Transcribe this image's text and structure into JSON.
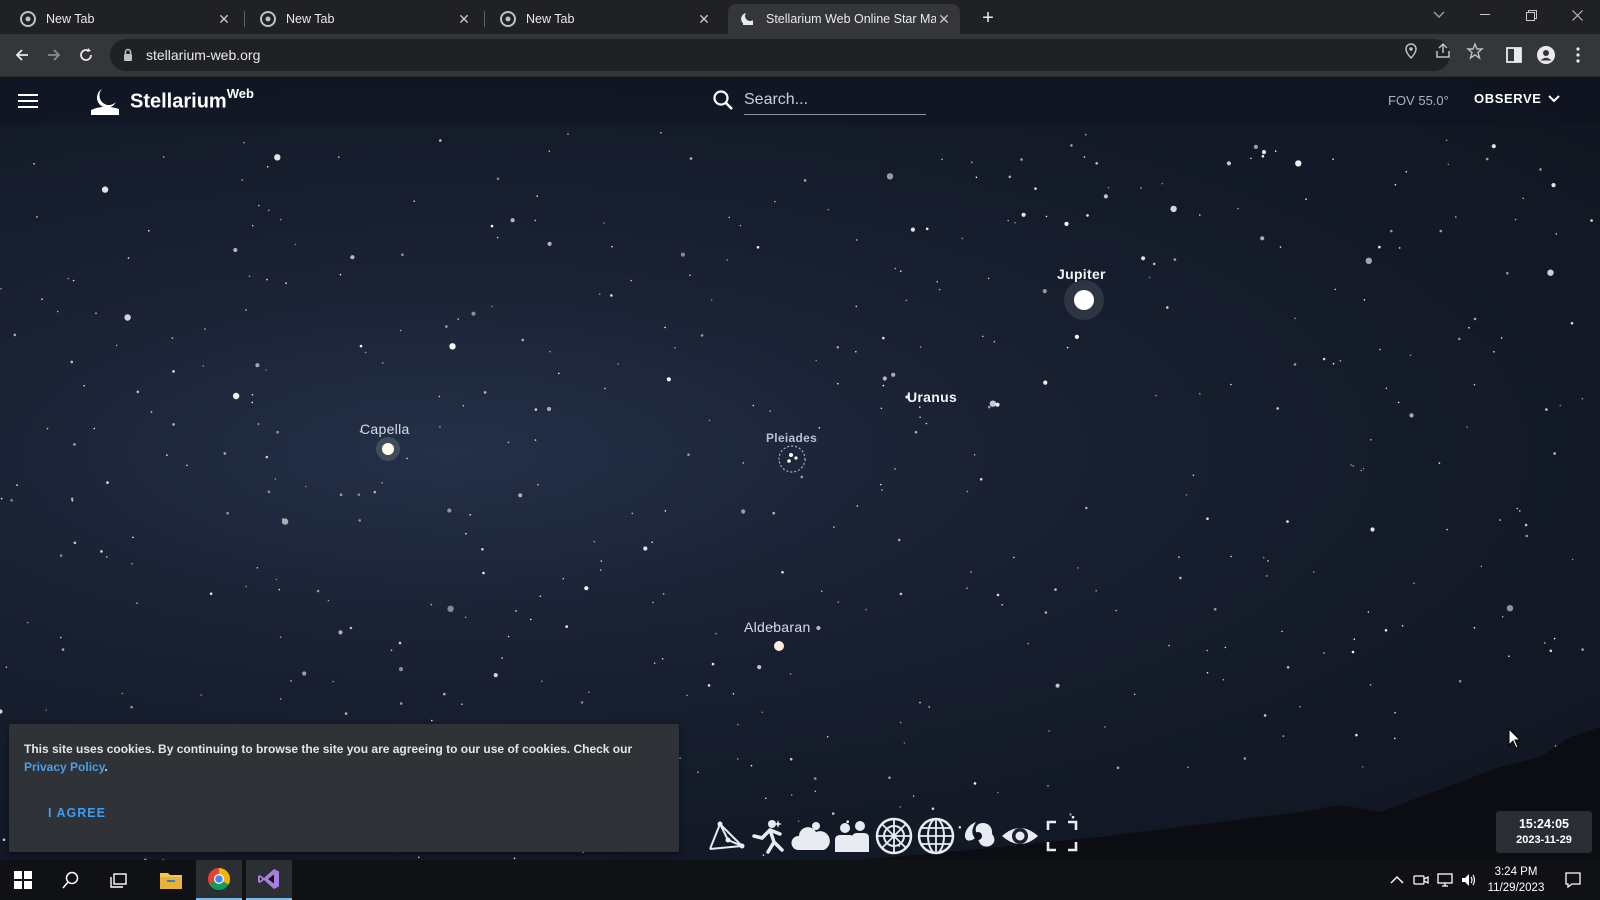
{
  "browser": {
    "tabs": [
      {
        "title": "New Tab",
        "active": false
      },
      {
        "title": "New Tab",
        "active": false
      },
      {
        "title": "New Tab",
        "active": false
      },
      {
        "title": "Stellarium Web Online Star Map",
        "active": true
      }
    ],
    "url": "stellarium-web.org"
  },
  "app": {
    "name": "Stellarium",
    "name_sup": "Web",
    "search_placeholder": "Search...",
    "fov": "FOV 55.0°",
    "observe_label": "OBSERVE"
  },
  "sky_labels": {
    "jupiter": "Jupiter",
    "uranus": "Uranus",
    "capella": "Capella",
    "pleiades": "Pleiades",
    "aldebaran": "Aldebaran"
  },
  "cookie": {
    "text": "This site uses cookies. By continuing to browse the site you are agreeing to our use of cookies. Check our",
    "link": "Privacy Policy",
    "after_link": ".",
    "agree": "I AGREE"
  },
  "toolbar_icons": [
    "constellation-lines-icon",
    "constellation-art-icon",
    "atmosphere-icon",
    "landscape-icon",
    "azimuthal-grid-icon",
    "equatorial-grid-icon",
    "deep-sky-objects-icon",
    "night-mode-icon",
    "fullscreen-icon"
  ],
  "clock": {
    "time": "15:24:05",
    "date": "2023-11-29"
  },
  "taskbar": {
    "apps": [
      "windows-start-icon",
      "search-icon",
      "task-view-icon",
      "file-explorer-icon",
      "chrome-icon",
      "visual-studio-icon"
    ],
    "time": "3:24 PM",
    "date": "11/29/2023"
  }
}
